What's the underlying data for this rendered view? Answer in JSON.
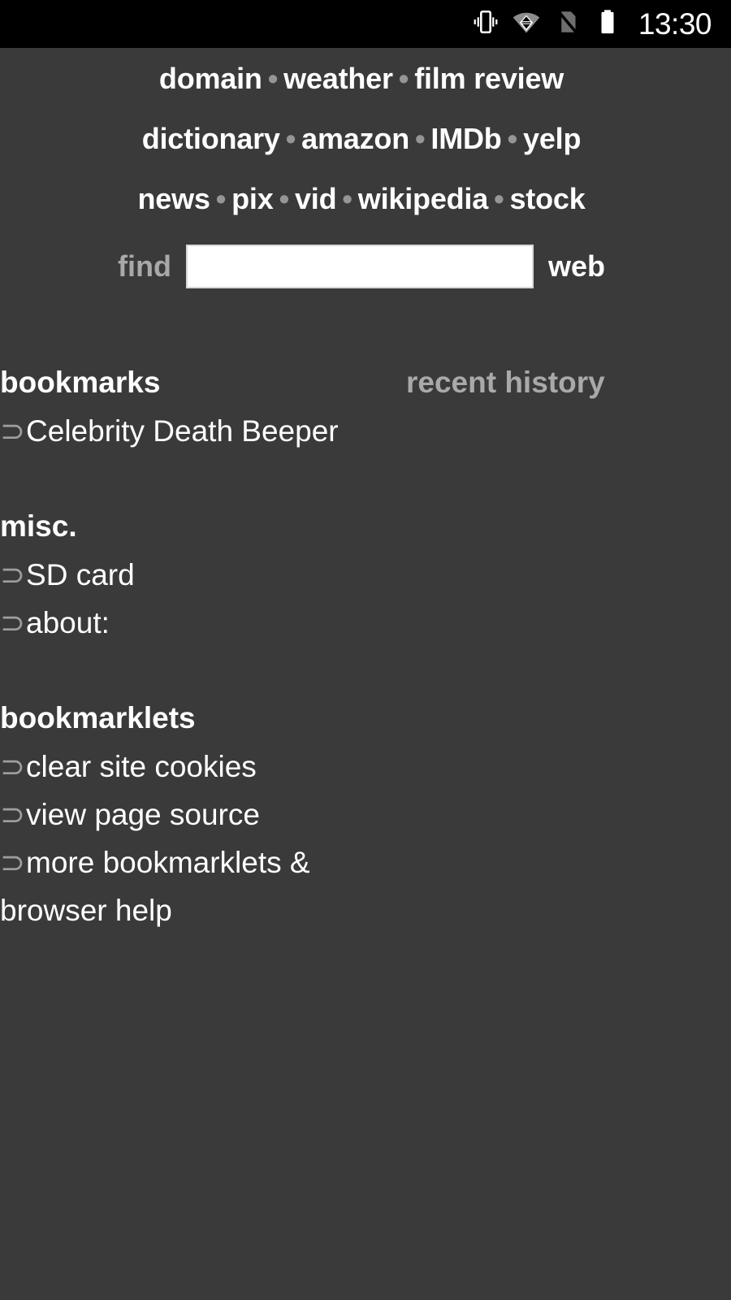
{
  "status_bar": {
    "icons": [
      {
        "name": "vibrate-icon",
        "label": "vibrate"
      },
      {
        "name": "wifi-icon",
        "label": "wifi"
      },
      {
        "name": "no-sim-icon",
        "label": "no sim card"
      },
      {
        "name": "battery-full-icon",
        "label": "battery full"
      }
    ],
    "time": "13:30"
  },
  "nav": {
    "separator": "•",
    "rows": [
      {
        "links": [
          "domain",
          "weather",
          "film review"
        ]
      },
      {
        "links": [
          "dictionary",
          "amazon",
          "IMDb",
          "yelp"
        ]
      },
      {
        "links": [
          "news",
          "pix",
          "vid",
          "wikipedia",
          "stock"
        ]
      }
    ]
  },
  "find_bar": {
    "label": "find",
    "input_value": "",
    "input_placeholder": "",
    "submit_label": "web"
  },
  "sections": [
    {
      "title": "bookmarks",
      "aside": "recent history",
      "items": [
        "Celebrity Death Beeper"
      ]
    },
    {
      "title": "misc.",
      "aside": "",
      "items": [
        "SD card",
        "about:"
      ]
    },
    {
      "title": "bookmarklets",
      "aside": "",
      "items": [
        "clear site cookies",
        "view page source",
        "more bookmarklets & browser help"
      ]
    }
  ],
  "bullet_glyph": "⊃",
  "colors": {
    "background": "#3a3a3a",
    "status_bar_background": "#000000",
    "text_primary": "#ffffff",
    "text_muted": "#a9a9a9",
    "separator": "#959595",
    "bullet": "#9e9e9e",
    "input_background": "#ffffff"
  }
}
